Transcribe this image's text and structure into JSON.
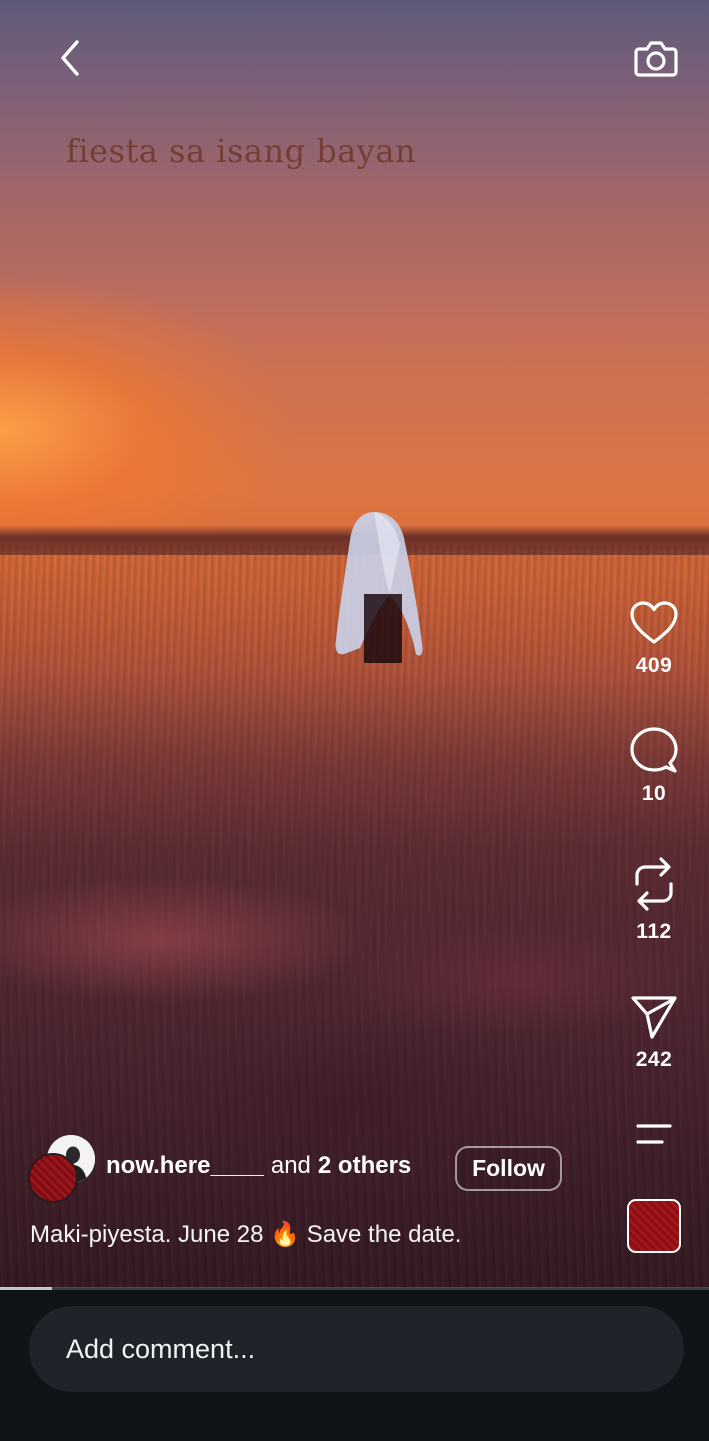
{
  "video": {
    "overlay_text": "fiesta sa isang bayan",
    "progress_fraction": 0.074
  },
  "icons": {
    "back": "chevron-left-icon",
    "camera": "camera-icon",
    "like": "heart-icon",
    "comment": "speech-bubble-icon",
    "repost": "repost-icon",
    "share": "send-icon",
    "more": "menu-lines-icon"
  },
  "actions": {
    "likes": "409",
    "comments": "10",
    "reposts": "112",
    "shares": "242"
  },
  "author": {
    "name": "now.here____",
    "connector": "and",
    "others": "2 others",
    "follow_label": "Follow"
  },
  "caption": {
    "text_before": "Maki-piyesta. June 28",
    "emoji": "🔥",
    "text_after": "Save the date."
  },
  "comment_box": {
    "placeholder": "Add comment..."
  },
  "colors": {
    "accent_red": "#8a0f14",
    "background": "#0f1418",
    "input_background": "#1e2429"
  }
}
